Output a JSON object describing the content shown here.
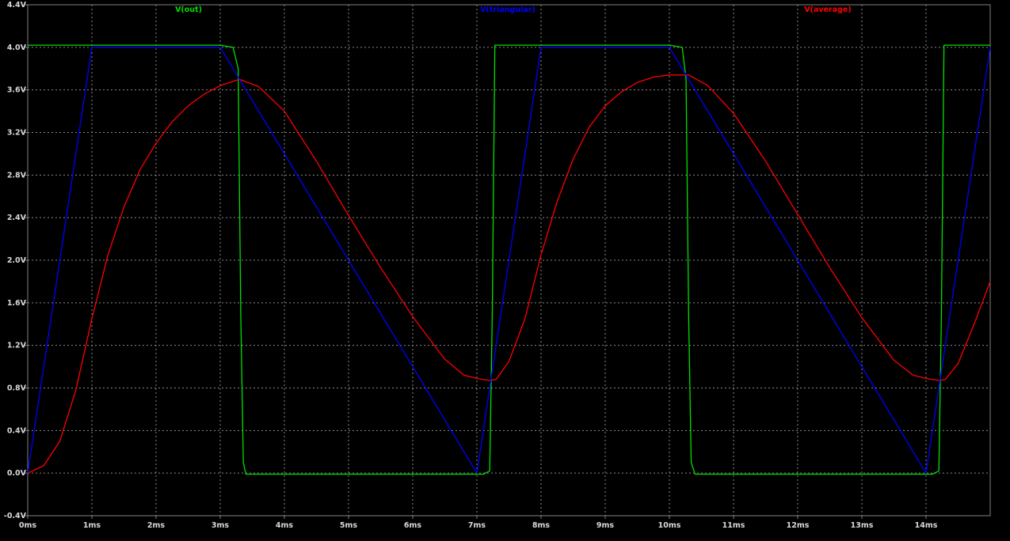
{
  "colors": {
    "background": "#000000",
    "axis": "#7f7f7f",
    "grid": "#8a8a8a",
    "tick_text": "#d9d9d9"
  },
  "chart_data": {
    "type": "line",
    "title": "",
    "xlabel": "",
    "ylabel": "",
    "xlim": [
      0,
      15
    ],
    "ylim": [
      -0.4,
      4.4
    ],
    "grid": true,
    "legend": "top",
    "x_ticks": [
      0,
      1,
      2,
      3,
      4,
      5,
      6,
      7,
      8,
      9,
      10,
      11,
      12,
      13,
      14
    ],
    "x_tick_labels": [
      "0ms",
      "1ms",
      "2ms",
      "3ms",
      "4ms",
      "5ms",
      "6ms",
      "7ms",
      "8ms",
      "9ms",
      "10ms",
      "11ms",
      "12ms",
      "13ms",
      "14ms"
    ],
    "y_ticks": [
      -0.4,
      0.0,
      0.4,
      0.8,
      1.2,
      1.6,
      2.0,
      2.4,
      2.8,
      3.2,
      3.6,
      4.0,
      4.4
    ],
    "y_tick_labels": [
      "-0.4V",
      "0.0V",
      "0.4V",
      "0.8V",
      "1.2V",
      "1.6V",
      "2.0V",
      "2.4V",
      "2.8V",
      "3.2V",
      "3.6V",
      "4.0V",
      "4.4V"
    ],
    "series": [
      {
        "name": "V(out)",
        "color": "#00e000",
        "x": [
          0,
          3.0,
          3.2,
          3.28,
          3.32,
          3.36,
          3.4,
          7.1,
          7.2,
          7.24,
          7.28,
          10.0,
          10.2,
          10.26,
          10.3,
          10.34,
          10.4,
          14.1,
          14.2,
          14.24,
          14.28,
          15.0
        ],
        "y": [
          4.02,
          4.02,
          4.0,
          3.8,
          1.5,
          0.1,
          -0.01,
          -0.01,
          0.02,
          1.5,
          4.02,
          4.02,
          4.0,
          3.7,
          1.5,
          0.1,
          -0.01,
          -0.01,
          0.02,
          1.5,
          4.02,
          4.02
        ]
      },
      {
        "name": "V(triangular)",
        "color": "#0000ff",
        "x": [
          0,
          1.0,
          3.0,
          7.0,
          8.0,
          10.0,
          14.0,
          15.0
        ],
        "y": [
          0.0,
          4.0,
          4.0,
          0.0,
          4.0,
          4.0,
          0.0,
          4.0
        ]
      },
      {
        "name": "V(average)",
        "color": "#ff0000",
        "x": [
          0,
          0.25,
          0.5,
          0.75,
          1.0,
          1.25,
          1.5,
          1.75,
          2.0,
          2.25,
          2.5,
          2.75,
          3.0,
          3.3,
          3.6,
          4.0,
          4.5,
          5.0,
          5.5,
          6.0,
          6.5,
          6.8,
          7.0,
          7.2,
          7.3,
          7.5,
          7.75,
          8.0,
          8.25,
          8.5,
          8.75,
          9.0,
          9.25,
          9.5,
          9.75,
          10.0,
          10.3,
          10.6,
          11.0,
          11.5,
          12.0,
          12.5,
          13.0,
          13.5,
          13.8,
          14.0,
          14.2,
          14.3,
          14.5,
          14.75,
          15.0
        ],
        "y": [
          0.0,
          0.07,
          0.3,
          0.78,
          1.45,
          2.05,
          2.5,
          2.85,
          3.1,
          3.3,
          3.45,
          3.56,
          3.64,
          3.7,
          3.63,
          3.4,
          2.93,
          2.42,
          1.93,
          1.47,
          1.07,
          0.92,
          0.89,
          0.87,
          0.88,
          1.05,
          1.45,
          2.05,
          2.55,
          2.95,
          3.25,
          3.45,
          3.58,
          3.67,
          3.72,
          3.74,
          3.74,
          3.64,
          3.38,
          2.93,
          2.43,
          1.93,
          1.46,
          1.06,
          0.92,
          0.89,
          0.87,
          0.88,
          1.03,
          1.4,
          1.8
        ]
      }
    ]
  }
}
